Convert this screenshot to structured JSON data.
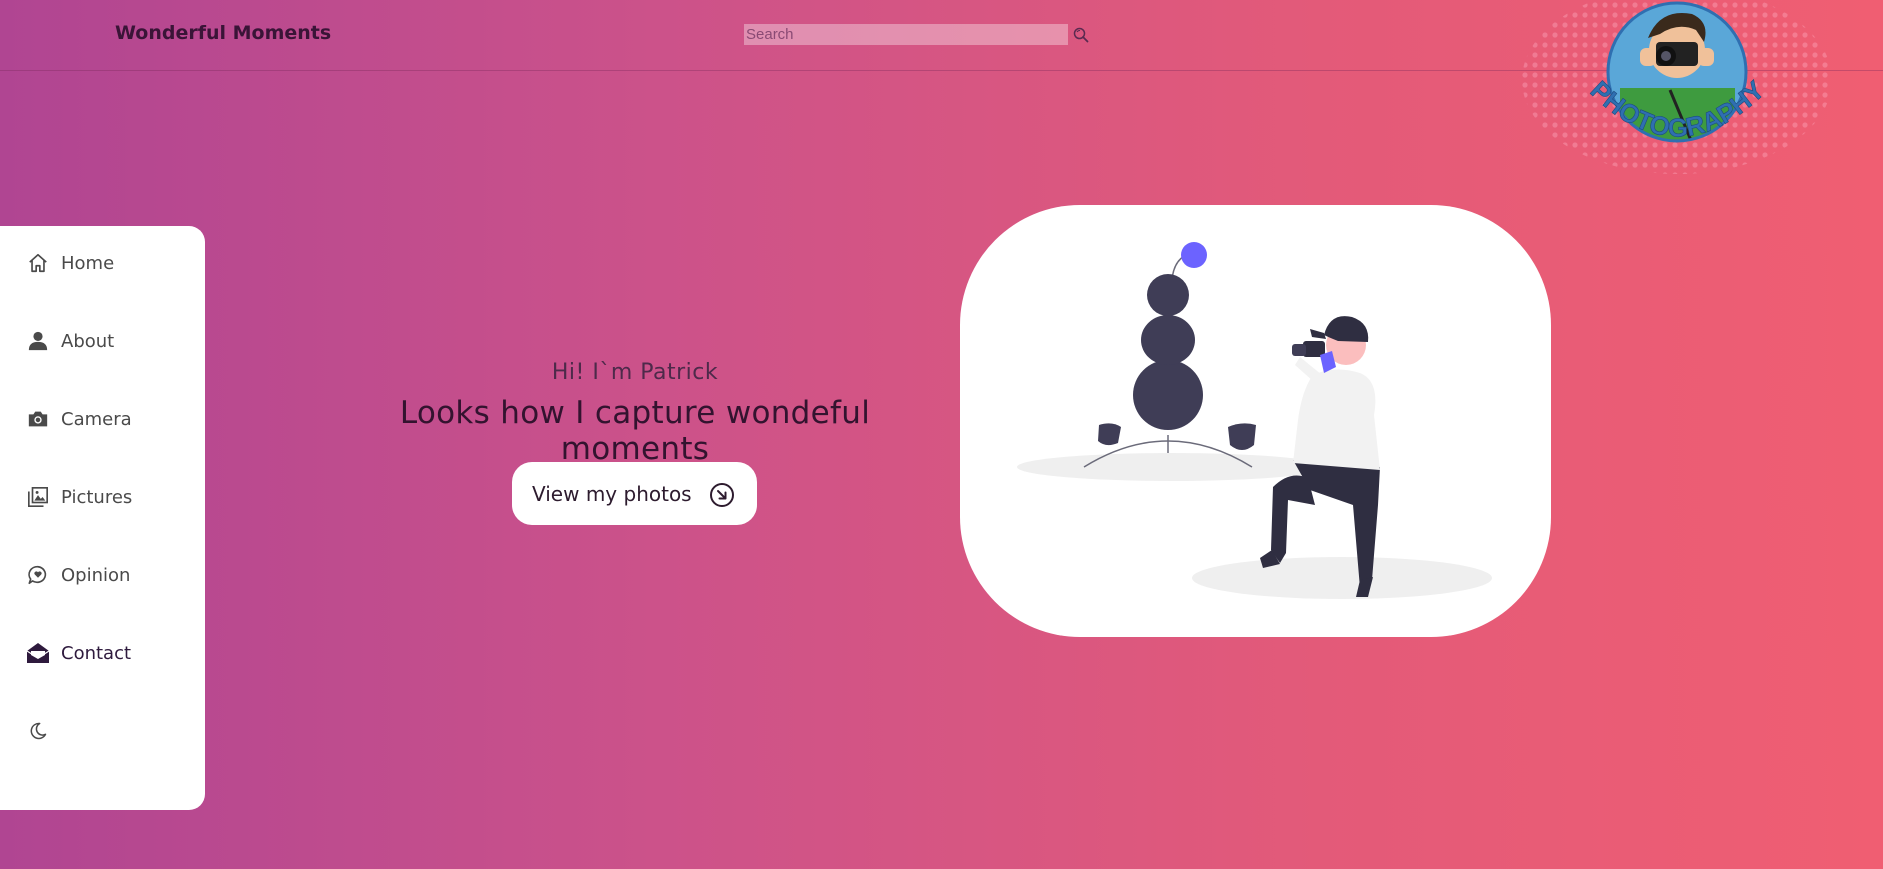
{
  "header": {
    "brand": "Wonderful Moments",
    "search": {
      "placeholder": "Search",
      "value": ""
    },
    "logo_text": "PHOTOGRAPHY"
  },
  "sidebar": {
    "items": [
      {
        "label": "Home",
        "icon": "home-icon"
      },
      {
        "label": "About",
        "icon": "user-icon"
      },
      {
        "label": "Camera",
        "icon": "camera-icon"
      },
      {
        "label": "Pictures",
        "icon": "images-icon"
      },
      {
        "label": "Opinion",
        "icon": "chat-heart-icon"
      },
      {
        "label": "Contact",
        "icon": "envelope-open-icon",
        "active": true
      }
    ],
    "theme_toggle_icon": "moon-icon"
  },
  "hero": {
    "greeting": "Hi! I`m Patrick",
    "tagline": "Looks how I capture wondeful moments",
    "cta_label": "View my photos",
    "cta_icon": "arrow-down-right-circle-icon"
  },
  "colors": {
    "gradient_start": "#b04592",
    "gradient_end": "#f05e72",
    "illustration_accent": "#6c63ff",
    "illustration_dark": "#3f3d56"
  }
}
